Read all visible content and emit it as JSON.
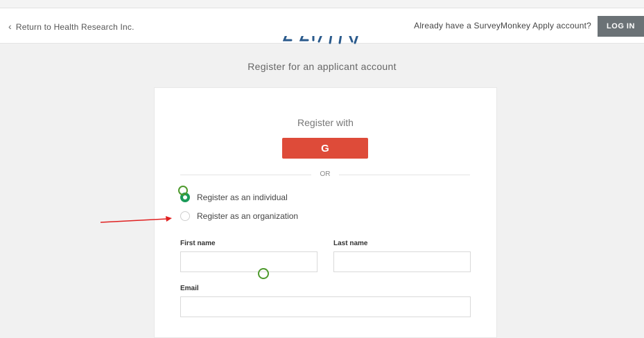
{
  "header": {
    "back_label": "Return to Health Research Inc.",
    "already_text": "Already have a SurveyMonkey Apply account?",
    "login_label": "LOG IN"
  },
  "logo": {
    "icon": "apply-logo"
  },
  "subtitle": "Register for an applicant account",
  "form": {
    "register_with": "Register with",
    "google_label": "G",
    "or_label": "OR",
    "options": [
      {
        "label": "Register as an individual",
        "checked": true
      },
      {
        "label": "Register as an organization",
        "checked": false
      }
    ],
    "first_name": {
      "label": "First name",
      "value": "",
      "placeholder": ""
    },
    "last_name": {
      "label": "Last name",
      "value": "",
      "placeholder": ""
    },
    "email": {
      "label": "Email",
      "value": "",
      "placeholder": ""
    }
  },
  "colors": {
    "google": "#de4b39",
    "login": "#6b7276",
    "radio_checked": "#1b9b59",
    "annotation_arrow": "#e02020",
    "annotation_circle": "#4e9a2d"
  }
}
